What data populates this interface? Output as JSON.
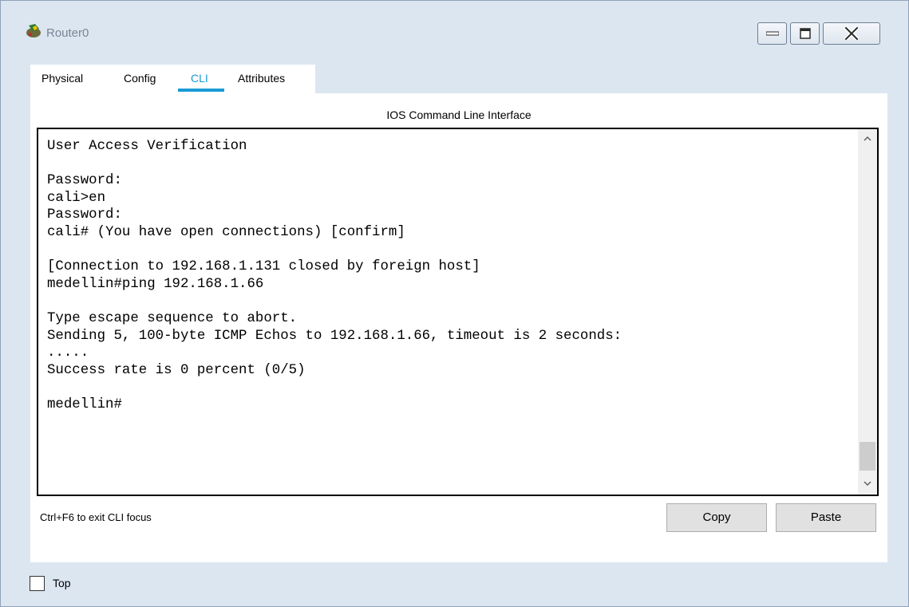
{
  "window": {
    "title": "Router0",
    "app_icon": "router-icon"
  },
  "titlebar_buttons": {
    "minimize": "minimize-icon",
    "maximize": "maximize-icon",
    "close": "close-icon"
  },
  "tabs": [
    {
      "label": "Physical",
      "active": false
    },
    {
      "label": "Config",
      "active": false
    },
    {
      "label": "CLI",
      "active": true
    },
    {
      "label": "Attributes",
      "active": false
    }
  ],
  "cli": {
    "section_title": "IOS Command Line Interface",
    "lines": [
      "User Access Verification",
      "",
      "Password:",
      "cali>en",
      "Password:",
      "cali# (You have open connections) [confirm]",
      "",
      "[Connection to 192.168.1.131 closed by foreign host]",
      "medellin#ping 192.168.1.66",
      "",
      "Type escape sequence to abort.",
      "Sending 5, 100-byte ICMP Echos to 192.168.1.66, timeout is 2 seconds:",
      ".....",
      "Success rate is 0 percent (0/5)",
      "",
      "medellin#"
    ],
    "hint": "Ctrl+F6 to exit CLI focus",
    "copy_label": "Copy",
    "paste_label": "Paste"
  },
  "footer": {
    "top_label": "Top",
    "top_checked": false
  },
  "colors": {
    "accent": "#1a9ad6",
    "window_bg": "#dce6f1"
  }
}
